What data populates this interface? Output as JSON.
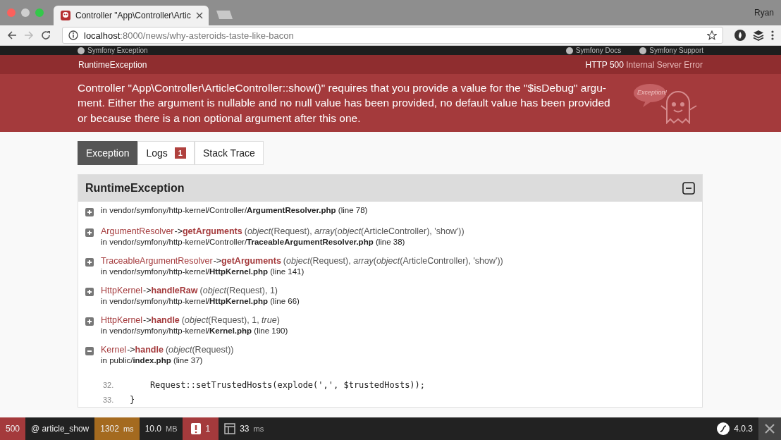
{
  "browser": {
    "tab_title": "Controller \"App\\Controller\\Artic",
    "user": "Ryan",
    "url_host": "localhost",
    "url_path": ":8000/news/why-asteroids-taste-like-bacon"
  },
  "top_links": {
    "left": "Symfony Exception",
    "right": [
      "Symfony Docs",
      "Symfony Support"
    ]
  },
  "header": {
    "exception_class": "RuntimeException",
    "status_code": "HTTP 500",
    "status_text": "Internal Server Error",
    "message": "Controller \"App\\Controller\\ArticleController::show()\" requires that you provide a value for the \"$isDebug\" argu- ment. Either the argument is nullable and no null value has been provided, no default value has been provided or because there is a non optional argument after this one.",
    "mascot_text": "Exception!"
  },
  "tabs": [
    {
      "label": "Exception",
      "selected": true
    },
    {
      "label": "Logs",
      "badge": "1",
      "selected": false
    },
    {
      "label": "Stack Trace",
      "selected": false
    }
  ],
  "panel": {
    "title": "RuntimeException",
    "expanded": true,
    "frames": [
      {
        "expanded": false,
        "file_prefix": "in vendor/symfony/http-kernel/Controller/",
        "file": "ArgumentResolver.php",
        "line": "(line 78)"
      },
      {
        "expanded": false,
        "class": "ArgumentResolver",
        "arrow": "->",
        "method": "getArguments",
        "args": "(*object*(Request), *array*(*object*(ArticleController), 'show'))",
        "file_prefix": "in vendor/symfony/http-kernel/Controller/",
        "file": "TraceableArgumentResolver.php",
        "line": "(line 38)"
      },
      {
        "expanded": false,
        "class": "TraceableArgumentResolver",
        "arrow": "->",
        "method": "getArguments",
        "args": "(*object*(Request), *array*(*object*(ArticleController), 'show'))",
        "file_prefix": "in vendor/symfony/http-kernel/",
        "file": "HttpKernel.php",
        "line": "(line 141)"
      },
      {
        "expanded": false,
        "class": "HttpKernel",
        "arrow": "->",
        "method": "handleRaw",
        "args": "(*object*(Request), 1)",
        "file_prefix": "in vendor/symfony/http-kernel/",
        "file": "HttpKernel.php",
        "line": "(line 66)"
      },
      {
        "expanded": false,
        "class": "HttpKernel",
        "arrow": "->",
        "method": "handle",
        "args": "(*object*(Request), 1, *true*)",
        "file_prefix": "in vendor/symfony/http-kernel/",
        "file": "Kernel.php",
        "line": "(line 190)"
      },
      {
        "expanded": true,
        "class": "Kernel",
        "arrow": "->",
        "method": "handle",
        "args": "(*object*(Request))",
        "file_prefix": "in public/",
        "file": "index.php",
        "line": "(line 37)",
        "code": [
          {
            "number": "32.",
            "text": "    Request::setTrustedHosts(explode(',', $trustedHosts));"
          },
          {
            "number": "33.",
            "text": "}"
          }
        ]
      }
    ]
  },
  "toolbar": {
    "status": "500",
    "route": "@ article_show",
    "time": "1302",
    "time_unit": "ms",
    "memory": "10.0",
    "memory_unit": "MB",
    "errors": "1",
    "db_time": "33",
    "db_unit": "ms",
    "version": "4.0.3"
  }
}
